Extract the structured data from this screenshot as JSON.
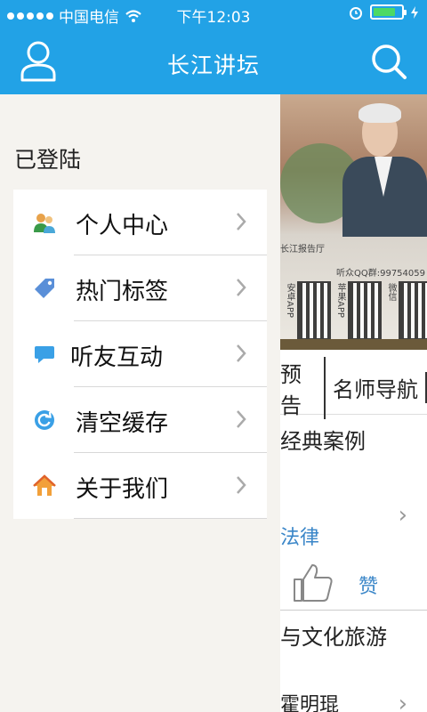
{
  "status_bar": {
    "carrier": "中国电信",
    "time": "下午12:03"
  },
  "header": {
    "title": "长江讲坛"
  },
  "colors": {
    "header_bg": "#22a2e6",
    "drawer_bg": "#f5f3ef",
    "link_blue": "#3a86c8"
  },
  "drawer": {
    "login_status": "已登陆",
    "menu": [
      {
        "label": "个人中心",
        "icon": "user-center-icon"
      },
      {
        "label": "热门标签",
        "icon": "tag-icon"
      },
      {
        "label": "听友互动",
        "icon": "chat-bubble-icon"
      },
      {
        "label": "清空缓存",
        "icon": "refresh-icon"
      },
      {
        "label": "关于我们",
        "icon": "home-icon"
      }
    ]
  },
  "main": {
    "banner": {
      "caption_hall": "长江报告厅",
      "qq_group": "听众QQ群:99754059",
      "qr_labels": [
        "安卓APP",
        "苹果APP",
        "微信"
      ]
    },
    "tabs": [
      "预告",
      "名师导航"
    ],
    "section1_title": "经典案例",
    "row1_link": "法律",
    "like_label": "赞",
    "section2_title": "与文化旅游",
    "row2_text": "霍明琨"
  }
}
